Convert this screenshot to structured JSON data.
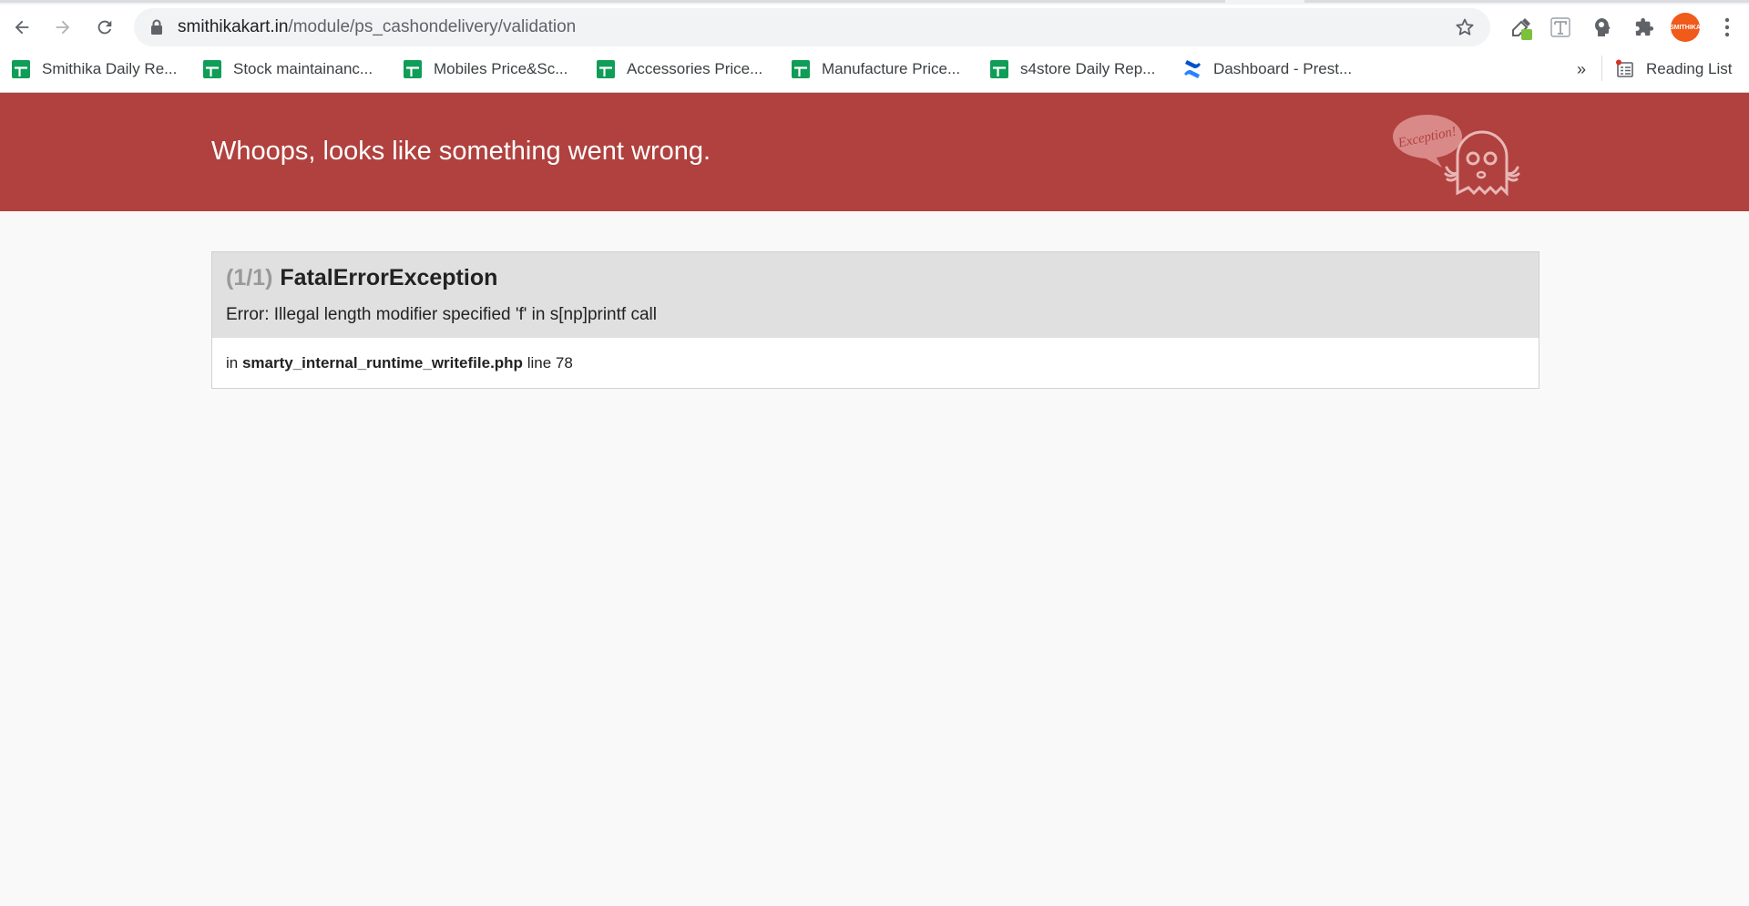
{
  "browser": {
    "url_host": "smithikakart.in",
    "url_path": "/module/ps_cashondelivery/validation",
    "avatar_text": "SMITHIKA",
    "bookmarks": [
      {
        "label": "Smithika Daily Re...",
        "icon": "sheets-icon"
      },
      {
        "label": "Stock maintainanc...",
        "icon": "sheets-icon"
      },
      {
        "label": "Mobiles Price&Sc...",
        "icon": "sheets-icon"
      },
      {
        "label": "Accessories Price...",
        "icon": "sheets-icon"
      },
      {
        "label": "Manufacture Price...",
        "icon": "sheets-icon"
      },
      {
        "label": "s4store Daily Rep...",
        "icon": "sheets-icon"
      },
      {
        "label": "Dashboard - Prest...",
        "icon": "confluence-icon"
      }
    ],
    "overflow_label": "»",
    "reading_list_label": "Reading List"
  },
  "page": {
    "banner_title": "Whoops, looks like something went wrong.",
    "mascot_text": "Exception!",
    "exception": {
      "count": "(1/1)",
      "class": "FatalErrorException",
      "message": "Error: Illegal length modifier specified 'f' in s[np]printf call",
      "location_prefix": "in",
      "file": "smarty_internal_runtime_writefile.php",
      "line_text": "line 78"
    }
  },
  "colors": {
    "banner": "#b0413e",
    "panel_header": "#e0e0e0",
    "page_background": "#f9f9f9"
  }
}
